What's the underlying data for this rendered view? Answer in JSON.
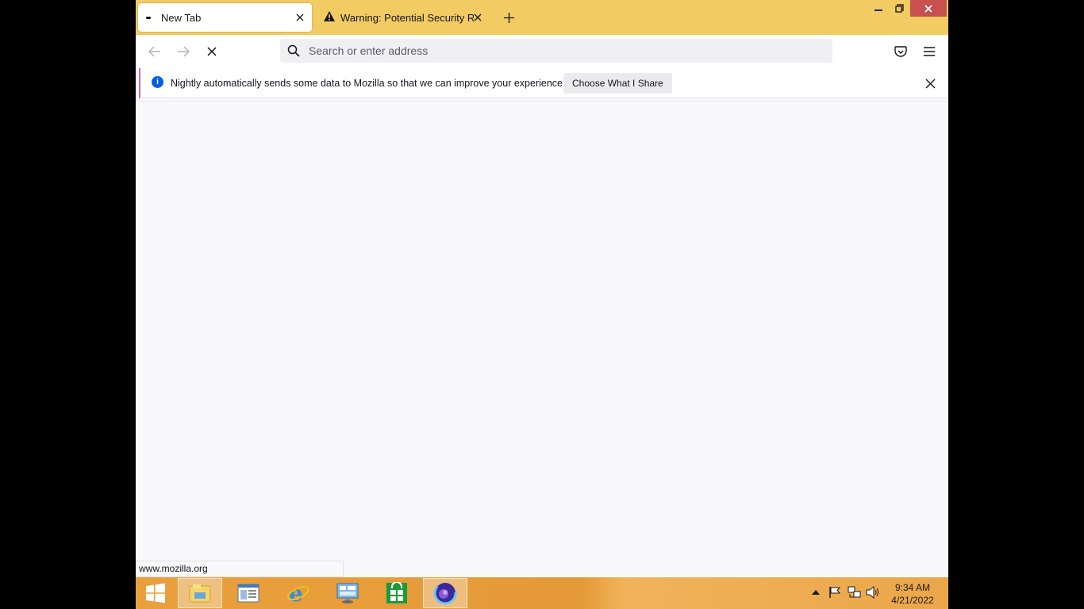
{
  "window": {
    "tabs": [
      {
        "label": "New Tab",
        "active": true
      },
      {
        "label": "Warning: Potential Security Risk Ahead",
        "active": false
      }
    ]
  },
  "navbar": {
    "url_placeholder": "Search or enter address"
  },
  "notification": {
    "message": "Nightly automatically sends some data to Mozilla so that we can improve your experience.",
    "button_label": "Choose What I Share"
  },
  "statusbar": {
    "text": "www.mozilla.org"
  },
  "taskbar": {
    "apps": [
      "start-button",
      "file-explorer",
      "control-panel",
      "internet-explorer",
      "remote-desktop",
      "store",
      "firefox-nightly"
    ],
    "clock_time": "9:34 AM",
    "clock_date": "4/21/2022"
  },
  "colors": {
    "titlebar": "#f2cb63",
    "accent": "#0060df",
    "taskbar": "#e8a03c"
  }
}
